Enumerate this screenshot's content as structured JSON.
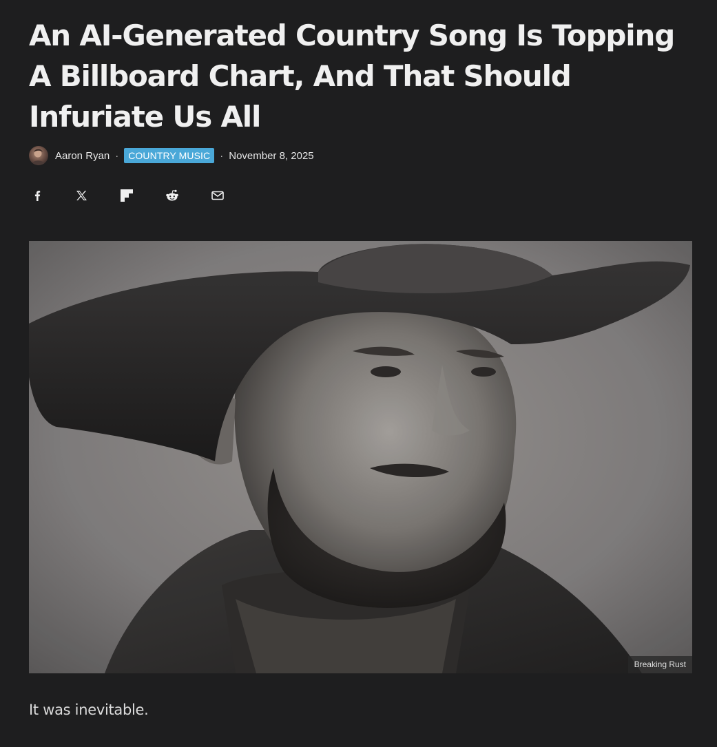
{
  "article": {
    "headline": "An AI-Generated Country Song Is Topping A Billboard Chart, And That Should Infuriate Us All",
    "author": "Aaron Ryan",
    "separator": "·",
    "category": "COUNTRY MUSIC",
    "date": "November 8, 2025",
    "image_credit": "Breaking Rust",
    "lede": "It was inevitable."
  },
  "share": {
    "items": [
      {
        "icon": "facebook-icon"
      },
      {
        "icon": "x-icon"
      },
      {
        "icon": "flipboard-icon"
      },
      {
        "icon": "reddit-icon"
      },
      {
        "icon": "email-icon"
      }
    ]
  },
  "colors": {
    "background": "#1e1e1f",
    "category_badge": "#4aa8d8",
    "text": "#ededed"
  }
}
